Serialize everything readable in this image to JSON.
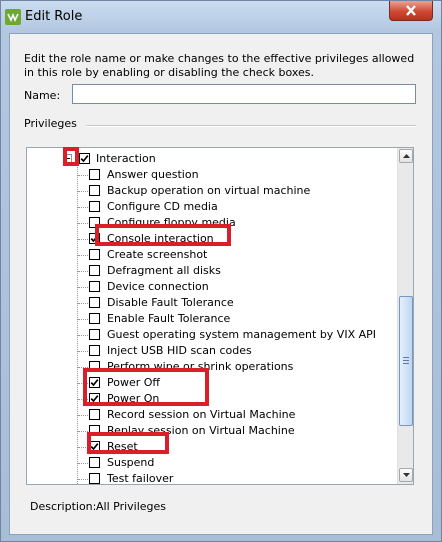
{
  "window": {
    "title": "Edit Role",
    "icon": "vsphere-logo-icon",
    "close_icon": "close-icon"
  },
  "instructions": "Edit the role name or make changes to the effective privileges allowed in this role by enabling or disabling the check boxes.",
  "name_field": {
    "label": "Name:",
    "value": "",
    "placeholder": ""
  },
  "privileges_label": "Privileges",
  "tree": {
    "parent": {
      "label": "Interaction",
      "checked": true,
      "expanded": true
    },
    "items": [
      {
        "label": "Answer question",
        "checked": false
      },
      {
        "label": "Backup operation on virtual machine",
        "checked": false
      },
      {
        "label": "Configure CD media",
        "checked": false
      },
      {
        "label": "Configure floppy media",
        "checked": false
      },
      {
        "label": "Console interaction",
        "checked": true
      },
      {
        "label": "Create screenshot",
        "checked": false
      },
      {
        "label": "Defragment all disks",
        "checked": false
      },
      {
        "label": "Device connection",
        "checked": false
      },
      {
        "label": "Disable Fault Tolerance",
        "checked": false
      },
      {
        "label": "Enable Fault Tolerance",
        "checked": false
      },
      {
        "label": "Guest operating system management by VIX API",
        "checked": false
      },
      {
        "label": "Inject USB HID scan codes",
        "checked": false
      },
      {
        "label": "Perform wipe or shrink operations",
        "checked": false
      },
      {
        "label": "Power Off",
        "checked": true
      },
      {
        "label": "Power On",
        "checked": true
      },
      {
        "label": "Record session on Virtual Machine",
        "checked": false
      },
      {
        "label": "Replay session on Virtual Machine",
        "checked": false
      },
      {
        "label": "Reset",
        "checked": true
      },
      {
        "label": "Suspend",
        "checked": false
      },
      {
        "label": "Test failover",
        "checked": false
      }
    ]
  },
  "description": {
    "label": "Description:",
    "value": "All Privileges"
  },
  "colors": {
    "highlight": "#d9202a",
    "scroll_thumb": "#bfd6f2",
    "window_frame": "#b3c8e0"
  }
}
